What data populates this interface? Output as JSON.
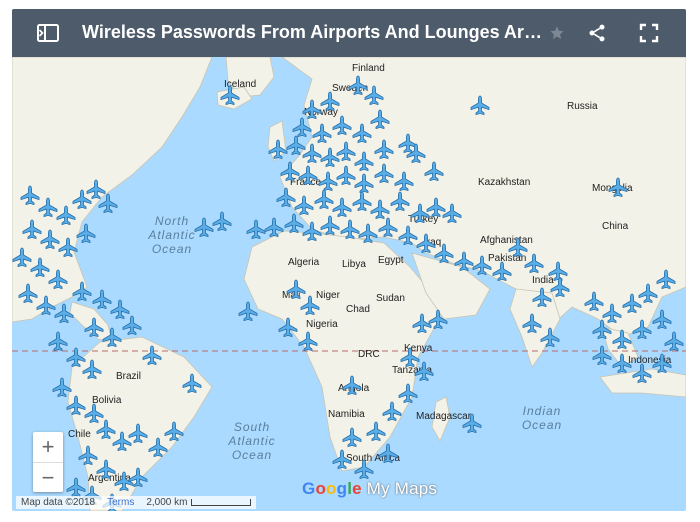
{
  "header": {
    "title": "Wireless Passwords From Airports And Lounges Around T...",
    "bg_color": "#4d5b6a"
  },
  "icons": {
    "sidebar": "sidebar-toggle-icon",
    "star": "star-icon",
    "share": "share-icon",
    "fullscreen": "fullscreen-icon",
    "marker": "airplane-icon"
  },
  "colors": {
    "water": "#aadaff",
    "land": "#f3f2e8",
    "marker": "#5aaee8",
    "marker_outline": "#2a6fa8",
    "equator": "#b56a6a"
  },
  "map": {
    "countries": [
      "Finland",
      "Sweden",
      "Russia",
      "Kazakhstan",
      "Mongolia",
      "China",
      "Turkey",
      "Iraq",
      "Afghanistan",
      "Pakistan",
      "India",
      "Algeria",
      "Libya",
      "Egypt",
      "Mali",
      "Niger",
      "Chad",
      "Sudan",
      "Nigeria",
      "Kenya",
      "DRC",
      "Tanzania",
      "Angola",
      "Namibia",
      "South Africa",
      "Madagascar",
      "Brazil",
      "Bolivia",
      "Chile",
      "Argentina",
      "Indonesia",
      "Iceland",
      "Norway",
      "France"
    ],
    "ocean_north_atlantic": [
      "North",
      "Atlantic",
      "Ocean"
    ],
    "ocean_south_atlantic": [
      "South",
      "Atlantic",
      "Ocean"
    ],
    "ocean_indian": [
      "Indian",
      "Ocean"
    ]
  },
  "controls": {
    "zoom_in": "+",
    "zoom_out": "−"
  },
  "attribution": {
    "map_data": "Map data ©2018",
    "terms": "Terms",
    "scale": "2,000 km"
  },
  "logo": {
    "google": "Google",
    "mymaps": "My Maps"
  }
}
